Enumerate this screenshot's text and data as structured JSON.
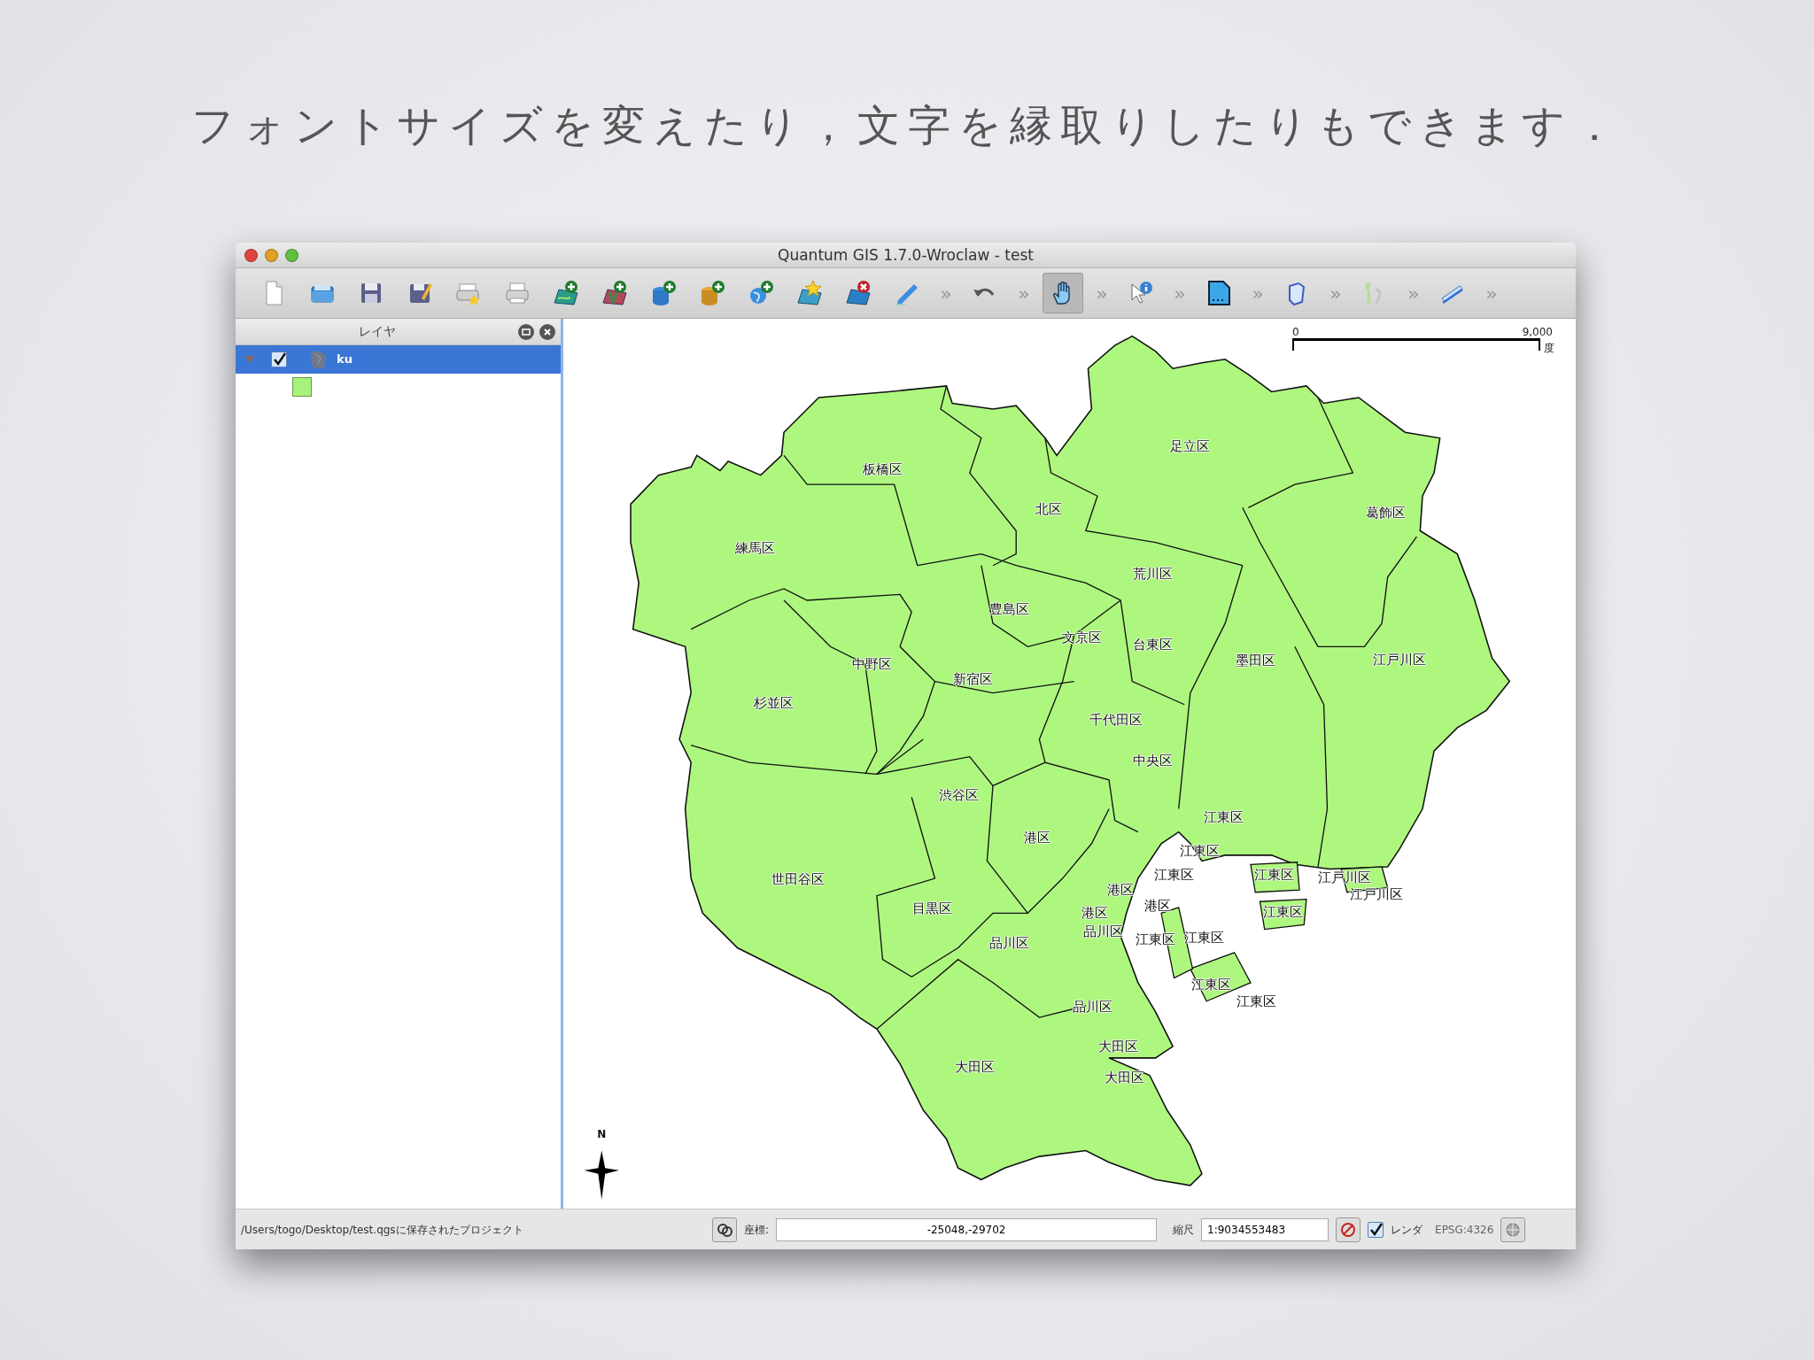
{
  "slide": {
    "heading": "フォントサイズを変えたり，文字を縁取りしたりもできます．"
  },
  "window": {
    "title": "Quantum GIS 1.7.0-Wroclaw - test"
  },
  "toolbar": [
    {
      "kind": "icon",
      "selected": false
    },
    {
      "kind": "icon",
      "selected": false
    },
    {
      "kind": "icon",
      "selected": false
    },
    {
      "kind": "icon",
      "selected": false
    },
    {
      "kind": "icon",
      "selected": false
    },
    {
      "kind": "icon",
      "selected": false
    },
    {
      "kind": "icon",
      "selected": false
    },
    {
      "kind": "icon",
      "selected": false
    },
    {
      "kind": "icon",
      "selected": false
    },
    {
      "kind": "icon",
      "selected": false
    },
    {
      "kind": "icon",
      "selected": false
    },
    {
      "kind": "icon",
      "selected": false
    },
    {
      "kind": "icon",
      "selected": false
    },
    {
      "kind": "icon",
      "selected": false
    },
    {
      "kind": "chevron",
      "text": "»"
    },
    {
      "kind": "icon",
      "selected": false
    },
    {
      "kind": "chevron",
      "text": "»"
    },
    {
      "kind": "icon",
      "selected": true
    },
    {
      "kind": "chevron",
      "text": "»"
    },
    {
      "kind": "icon",
      "selected": false
    },
    {
      "kind": "chevron",
      "text": "»"
    },
    {
      "kind": "icon",
      "selected": false
    },
    {
      "kind": "chevron",
      "text": "»"
    },
    {
      "kind": "icon",
      "selected": false
    },
    {
      "kind": "chevron",
      "text": "»"
    },
    {
      "kind": "icon",
      "selected": false
    },
    {
      "kind": "chevron",
      "text": "»"
    },
    {
      "kind": "icon",
      "selected": false
    },
    {
      "kind": "chevron",
      "text": "»"
    }
  ],
  "layers_panel": {
    "title": "レイヤ",
    "layers": [
      {
        "name": "ku",
        "selected": true,
        "expanded": true,
        "checked": true,
        "color": "#a6f27c"
      }
    ]
  },
  "map": {
    "scale_bar": {
      "start": "0",
      "end": "9,000",
      "unit": "度"
    },
    "north_arrow": "N",
    "labels": [
      {
        "text": "足立区"
      },
      {
        "text": "板橋区"
      },
      {
        "text": "北区"
      },
      {
        "text": "葛飾区"
      },
      {
        "text": "練馬区"
      },
      {
        "text": "荒川区"
      },
      {
        "text": "豊島区"
      },
      {
        "text": "文京区"
      },
      {
        "text": "台東区"
      },
      {
        "text": "中野区"
      },
      {
        "text": "墨田区"
      },
      {
        "text": "江戸川区"
      },
      {
        "text": "新宿区"
      },
      {
        "text": "杉並区"
      },
      {
        "text": "千代田区"
      },
      {
        "text": "中央区"
      },
      {
        "text": "渋谷区"
      },
      {
        "text": "江東区"
      },
      {
        "text": "港区"
      },
      {
        "text": "江東区"
      },
      {
        "text": "世田谷区"
      },
      {
        "text": "江東区"
      },
      {
        "text": "江東区"
      },
      {
        "text": "江戸川区"
      },
      {
        "text": "港区"
      },
      {
        "text": "江戸川区"
      },
      {
        "text": "目黒区"
      },
      {
        "text": "港区"
      },
      {
        "text": "港区"
      },
      {
        "text": "江東区"
      },
      {
        "text": "品川区"
      },
      {
        "text": "品川区"
      },
      {
        "text": "江東区"
      },
      {
        "text": "江東区"
      },
      {
        "text": "江東区"
      },
      {
        "text": "江東区"
      },
      {
        "text": "品川区"
      },
      {
        "text": "大田区"
      },
      {
        "text": "大田区"
      },
      {
        "text": "大田区"
      }
    ]
  },
  "status_bar": {
    "message": "/Users/togo/Desktop/test.qgsに保存されたプロジェクト",
    "coordinate_label": "座標:",
    "coordinate": "-25048,-29702",
    "scale_label": "縮尺",
    "scale": "1:9034553483",
    "render_checked": true,
    "render_label": "レンダ",
    "crs": "EPSG:4326"
  }
}
